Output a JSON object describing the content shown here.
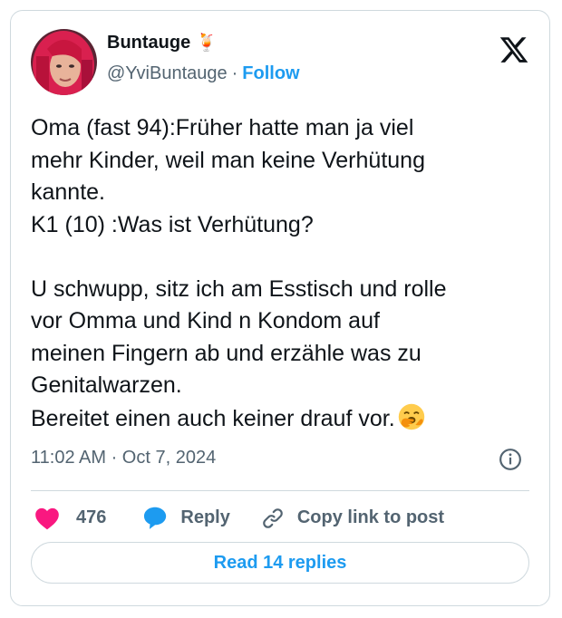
{
  "author": {
    "display_name": "Buntauge",
    "name_emoji": "🍹",
    "handle": "@YviBuntauge",
    "separator": "·",
    "follow_label": "Follow"
  },
  "tweet": {
    "text": "Oma (fast 94):Früher hatte man ja viel\nmehr Kinder, weil man keine Verhütung\nkannte.\nK1 (10) :Was ist Verhütung?\n\nU schwupp, sitz ich am Esstisch und rolle\nvor Omma und Kind n Kondom auf\nmeinen Fingern ab und erzähle was zu\nGenitalwarzen.\nBereitet einen auch keiner drauf vor.",
    "trailing_emoji": "face-with-hand-over-mouth-emoji",
    "timestamp": "11:02 AM · Oct 7, 2024"
  },
  "actions": {
    "like_count": "476",
    "reply_label": "Reply",
    "copy_link_label": "Copy link to post"
  },
  "footer": {
    "read_replies_label": "Read 14 replies"
  },
  "icons": {
    "x_logo": "x-logo-icon",
    "info": "info-icon",
    "like": "heart-icon",
    "reply": "speech-bubble-icon",
    "copy": "link-icon"
  },
  "colors": {
    "accent": "#1d9bf0",
    "like": "#f91880",
    "text": "#0f1419",
    "muted": "#536471",
    "border": "#cfd9de"
  }
}
